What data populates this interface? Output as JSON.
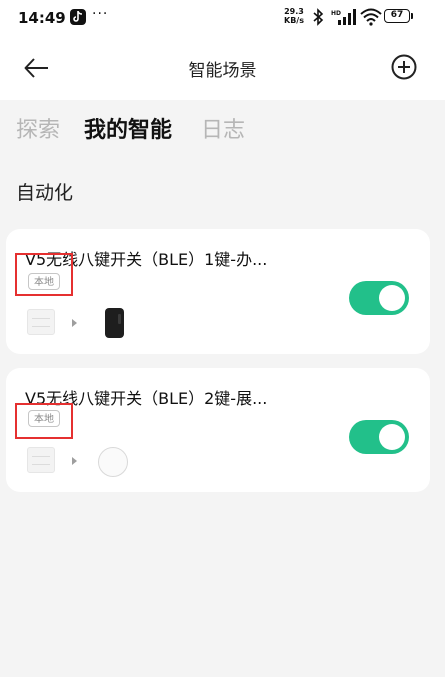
{
  "status_bar": {
    "time": "14:49",
    "more": "···",
    "net_speed_value": "29.3",
    "net_speed_unit": "KB/s",
    "battery": "67"
  },
  "nav": {
    "title": "智能场景",
    "back_icon": "arrow-left-icon",
    "add_icon": "plus-circle-icon"
  },
  "tabs": [
    {
      "label": "探索",
      "active": false
    },
    {
      "label": "我的智能",
      "active": true
    },
    {
      "label": "日志",
      "active": false
    }
  ],
  "section": {
    "title": "自动化"
  },
  "automations": [
    {
      "title": "V5无线八键开关（BLE）1键-办...",
      "badge": "本地",
      "trigger_icon": "wall-switch-icon",
      "target_icon": "phone-device-icon",
      "enabled": true
    },
    {
      "title": "V5无线八键开关（BLE）2键-展...",
      "badge": "本地",
      "trigger_icon": "wall-switch-icon",
      "target_icon": "round-sensor-icon",
      "enabled": true
    }
  ],
  "colors": {
    "accent": "#22c08a",
    "highlight": "#e53030",
    "background": "#f4f4f4"
  }
}
